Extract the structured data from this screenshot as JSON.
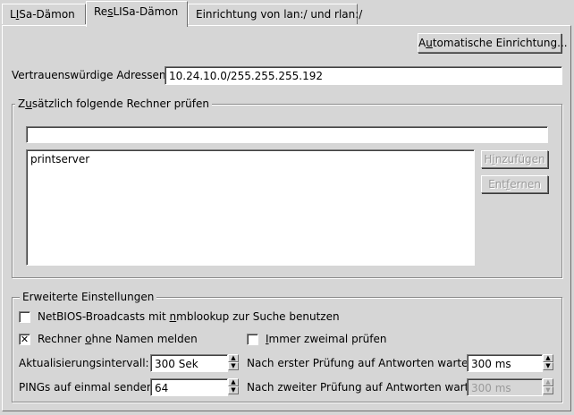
{
  "tabs": [
    {
      "label_pre": "L",
      "label_u": "I",
      "label_post": "Sa-Dämon"
    },
    {
      "label_pre": "Re",
      "label_u": "s",
      "label_post": "LISa-Dämon"
    },
    {
      "label_pre": "Einrichtung von lan:/ und rlan:/",
      "label_u": "",
      "label_post": ""
    }
  ],
  "auto_setup_button": {
    "label_pre": "A",
    "label_u": "u",
    "label_post": "tomatische Einrichtung..."
  },
  "trusted_addresses": {
    "label": "Vertrauenswürdige Adressen",
    "value": "10.24.10.0/255.255.255.192"
  },
  "extra_hosts": {
    "legend_pre": "Z",
    "legend_u": "u",
    "legend_post": "sätzlich folgende Rechner prüfen",
    "input_value": "",
    "list_items": [
      "printserver"
    ],
    "add_button": {
      "label_pre": "H",
      "label_u": "i",
      "label_post": "nzufügen"
    },
    "remove_button": {
      "label_pre": "Ent",
      "label_u": "f",
      "label_post": "ernen"
    }
  },
  "advanced": {
    "legend": "Erweiterte Einstellungen",
    "netbios_check": {
      "label_pre": "NetBIOS-Broadcasts mit ",
      "label_u": "n",
      "label_post": "mblookup zur Suche benutzen",
      "checked": false
    },
    "report_unnamed_check": {
      "label_pre": "Rechner ",
      "label_u": "o",
      "label_post": "hne Namen melden",
      "checked": true,
      "mark": "✕"
    },
    "check_twice": {
      "label_pre": "",
      "label_u": "I",
      "label_post": "mmer zweimal prüfen",
      "checked": false
    },
    "update_interval": {
      "label": "Aktualisierungsintervall:",
      "value": "300 Sek"
    },
    "pings_at_once": {
      "label": "PINGs auf einmal senden",
      "value": "64"
    },
    "wait_first": {
      "label": "Nach erster Prüfung auf Antworten warten",
      "value": "300 ms"
    },
    "wait_second": {
      "label": "Nach zweiter Prüfung auf Antworten warten",
      "value": "300 ms"
    }
  },
  "icons": {
    "spin_up": "▲",
    "spin_down": "▼"
  }
}
